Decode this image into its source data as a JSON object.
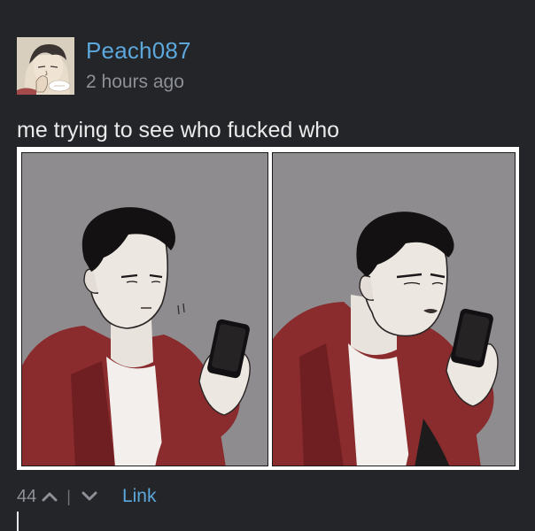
{
  "post": {
    "username": "Peach087",
    "timestamp": "2 hours ago",
    "caption": "me trying to see who fucked who"
  },
  "actions": {
    "vote_count": "44",
    "divider": "|",
    "link_label": "Link"
  },
  "icons": {
    "upvote": "chevron-up-icon",
    "downvote": "chevron-down-icon"
  },
  "colors": {
    "background": "#232529",
    "username": "#5ca8dc",
    "link": "#5ca8dc",
    "muted": "#8d9096",
    "caption": "#eaeaea"
  }
}
